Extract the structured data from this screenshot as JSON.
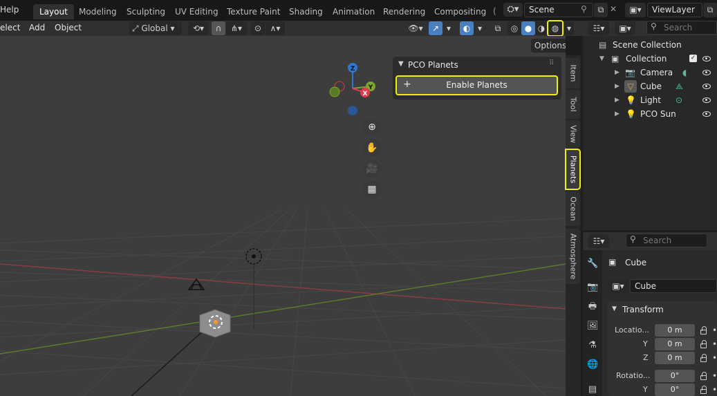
{
  "topbar": {
    "menu_help": "Help",
    "workspaces": [
      "Layout",
      "Modeling",
      "Sculpting",
      "UV Editing",
      "Texture Paint",
      "Shading",
      "Animation",
      "Rendering",
      "Compositing"
    ],
    "overflow_tab": "(",
    "scene_name": "Scene",
    "viewlayer_name": "ViewLayer"
  },
  "viewport_header": {
    "select": "elect",
    "add": "Add",
    "object": "Object",
    "orientation": "Global",
    "options": "Options"
  },
  "npanel": {
    "title": "PCO Planets",
    "enable_button": "Enable Planets",
    "plus": "+"
  },
  "gizmo": {
    "z": "Z",
    "y": "Y",
    "x": "X"
  },
  "sidebar_tabs": [
    "Item",
    "Tool",
    "View",
    "Planets",
    "Ocean",
    "Atmosphere"
  ],
  "outliner": {
    "search_placeholder": "Search",
    "scene_collection": "Scene Collection",
    "collection": "Collection",
    "items": [
      "Camera",
      "Cube",
      "Light",
      "PCO Sun"
    ]
  },
  "properties": {
    "search_placeholder": "Search",
    "object_name": "Cube",
    "data_name": "Cube",
    "panel_title": "Transform",
    "location_label": "Locatio...",
    "y_label": "Y",
    "z_label": "Z",
    "loc_x": "0 m",
    "loc_y": "0 m",
    "loc_z": "0 m",
    "rotation_label": "Rotatio...",
    "rot_x": "0°",
    "rot_y": "0°"
  },
  "colors": {
    "highlight": "#f5f000",
    "x_axis": "#e2384e",
    "y_axis": "#7aa62c",
    "z_axis": "#2d78d2"
  }
}
